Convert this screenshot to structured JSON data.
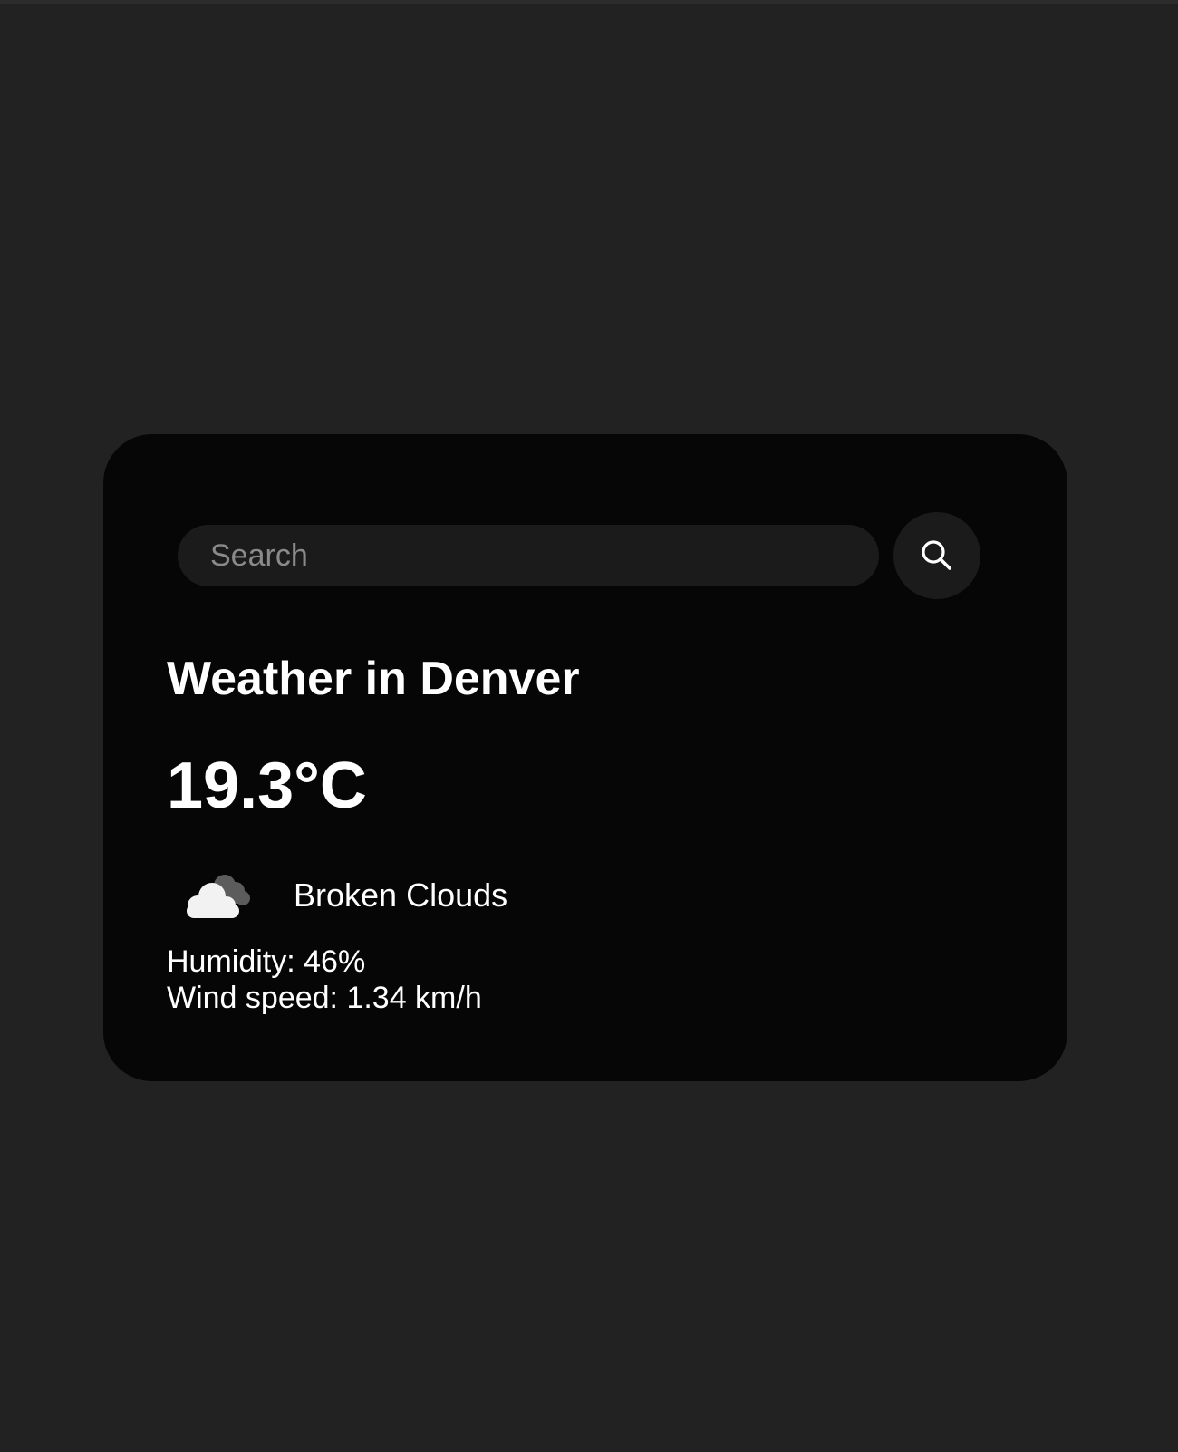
{
  "search": {
    "placeholder": "Search",
    "value": "",
    "button_icon": "search-icon"
  },
  "weather": {
    "title": "Weather in Denver",
    "temperature": "19.3°C",
    "icon": "broken-clouds-icon",
    "description": "Broken Clouds",
    "humidity": "Humidity: 46%",
    "wind": "Wind speed: 1.34 km/h"
  },
  "colors": {
    "page_background": "#222222",
    "card_background": "#060606",
    "input_background": "#1b1b1b",
    "text": "#ffffff",
    "placeholder": "#8a8a8a"
  }
}
